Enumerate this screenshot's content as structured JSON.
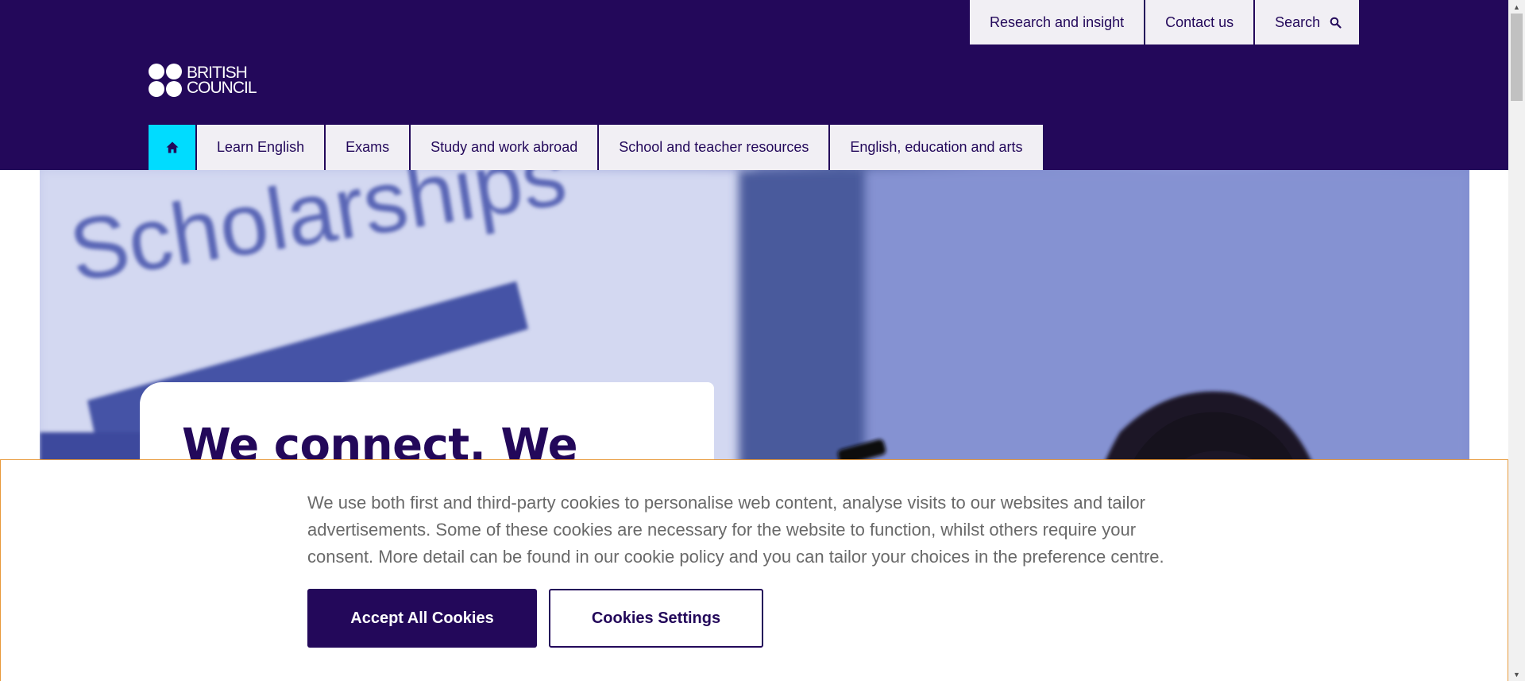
{
  "header": {
    "brand": "BRITISH COUNCIL",
    "brand_line1": "BRITISH",
    "brand_line2": "COUNCIL",
    "utility_nav": {
      "research": "Research and insight",
      "contact": "Contact us",
      "search": "Search"
    },
    "main_nav": {
      "home_icon": "home-icon",
      "items": [
        {
          "label": "Learn English"
        },
        {
          "label": "Exams"
        },
        {
          "label": "Study and work abroad"
        },
        {
          "label": "School and teacher resources"
        },
        {
          "label": "English, education and arts"
        }
      ]
    }
  },
  "hero": {
    "sign_text": "Scholarships",
    "title": "We connect. We"
  },
  "cookie_banner": {
    "text": "We use both first and third-party cookies to personalise web content, analyse visits to our websites and tailor advertisements. Some of these cookies are necessary for the website to function, whilst others require your consent. More detail can be found in our cookie policy and you can tailor your choices in the preference centre.",
    "accept_label": "Accept All Cookies",
    "settings_label": "Cookies Settings"
  },
  "colors": {
    "brand_purple": "#23085a",
    "nav_background": "#f1eff4",
    "home_accent": "#00dcff",
    "banner_border": "#e89a3c"
  }
}
